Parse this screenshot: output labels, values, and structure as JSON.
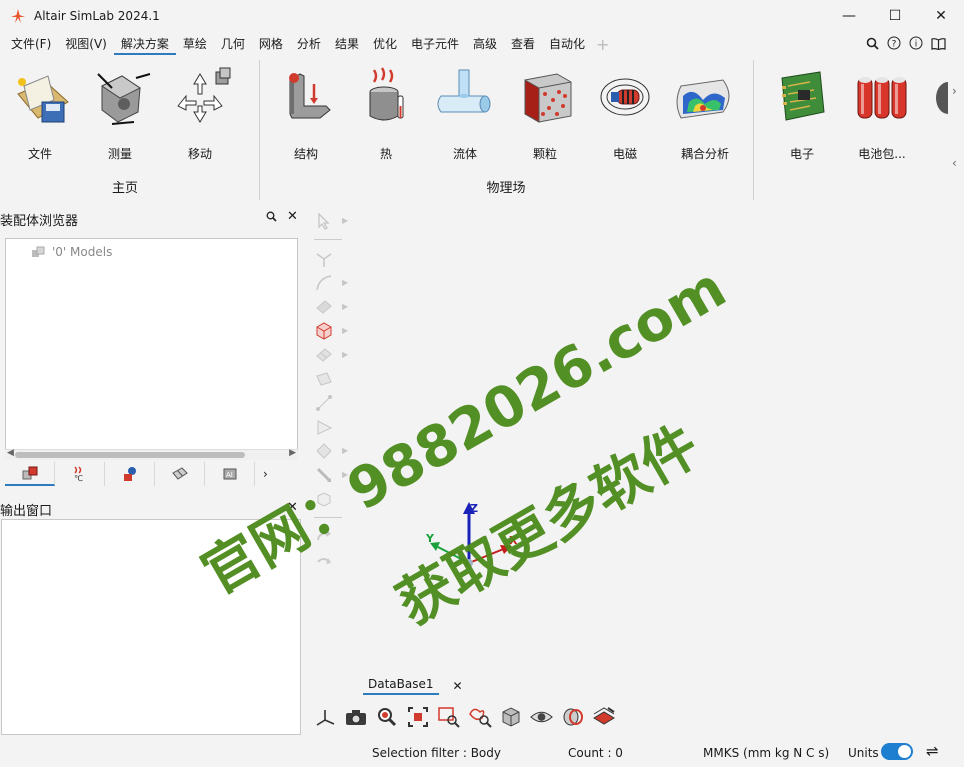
{
  "window": {
    "title": "Altair SimLab 2024.1",
    "minimize": "—",
    "maximize": "☐",
    "close": "✕"
  },
  "menu": {
    "items": [
      "文件(F)",
      "视图(V)",
      "解决方案",
      "草绘",
      "几何",
      "网格",
      "分析",
      "结果",
      "优化",
      "电子元件",
      "高级",
      "查看",
      "自动化"
    ],
    "active_index": 2,
    "plus": "+",
    "right_icons": [
      "search-icon",
      "help-icon",
      "info-icon",
      "book-icon"
    ]
  },
  "ribbon": {
    "groups": [
      {
        "label": "主页",
        "buttons": [
          {
            "label": "文件",
            "icon": "file-icon"
          },
          {
            "label": "测量",
            "icon": "measure-icon"
          },
          {
            "label": "移动",
            "icon": "move-icon"
          }
        ]
      },
      {
        "label": "物理场",
        "buttons": [
          {
            "label": "结构",
            "icon": "structure-icon"
          },
          {
            "label": "热",
            "icon": "thermal-icon"
          },
          {
            "label": "流体",
            "icon": "fluid-icon"
          },
          {
            "label": "颗粒",
            "icon": "particle-icon"
          },
          {
            "label": "电磁",
            "icon": "electromagnetic-icon"
          },
          {
            "label": "耦合分析",
            "icon": "coupled-icon"
          }
        ]
      },
      {
        "label": "",
        "buttons": [
          {
            "label": "电子",
            "icon": "electronics-icon"
          },
          {
            "label": "电池包...",
            "icon": "battery-icon"
          }
        ]
      }
    ]
  },
  "browser": {
    "title": "装配体浏览器",
    "tree": [
      {
        "label": "'0' Models"
      }
    ],
    "tabs": [
      "assembly-tab-icon",
      "thermal-tab-icon",
      "parts-tab-icon",
      "mesh-tab-icon",
      "ai-tab-icon"
    ],
    "more": "›"
  },
  "output": {
    "title": "输出窗口"
  },
  "watermark": {
    "line1": "官网：9882026.com",
    "line2": "获取更多软件"
  },
  "axes": {
    "z": "Z",
    "x": "X",
    "y": "Y"
  },
  "document": {
    "tab": "DataBase1",
    "close": "✕"
  },
  "status": {
    "selection_filter": "Selection filter : Body",
    "count": "Count : 0",
    "units_system": "MMKS (mm kg N C s)",
    "units_label": "Units",
    "units_toggle_on": true
  }
}
